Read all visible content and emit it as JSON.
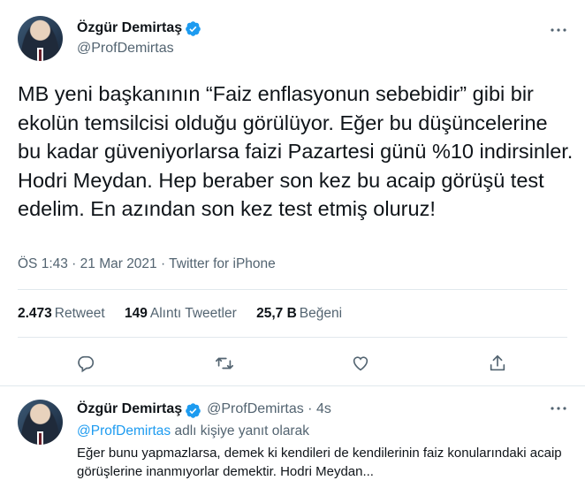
{
  "tweet": {
    "author_name": "Özgür Demirtaş",
    "author_handle": "@ProfDemirtas",
    "text": "MB yeni başkanının “Faiz enflasyonun sebebidir” gibi bir ekolün temsilcisi olduğu görülüyor. Eğer bu düşüncelerine bu kadar güveniyorlarsa faizi Pazartesi günü %10 indirsinler. Hodri Meydan. Hep beraber son kez bu acaip görüşü test edelim. En azından son kez test etmiş oluruz!",
    "meta": "ÖS 1:43 · 21 Mar 2021 · Twitter for iPhone",
    "stats": {
      "retweets_count": "2.473",
      "retweets_label": "Retweet",
      "quotes_count": "149",
      "quotes_label": "Alıntı Tweetler",
      "likes_count": "25,7 B",
      "likes_label": "Beğeni"
    },
    "actions": [
      "reply-icon",
      "retweet-icon",
      "like-icon",
      "share-icon"
    ],
    "more_icon": "more-icon"
  },
  "reply": {
    "author_name": "Özgür Demirtaş",
    "author_handle_time": "@ProfDemirtas · 4s",
    "replying_mention": "@ProfDemirtas",
    "replying_suffix": " adlı kişiye yanıt olarak",
    "text": "Eğer bunu yapmazlarsa, demek ki kendileri de kendilerinin faiz konularındaki acaip görüşlerine inanmıyorlar demektir. Hodri Meydan..."
  },
  "colors": {
    "accent": "#1d9bf0",
    "secondary_text": "#536471",
    "primary_text": "#0f1419",
    "divider": "#e1e8ed"
  }
}
